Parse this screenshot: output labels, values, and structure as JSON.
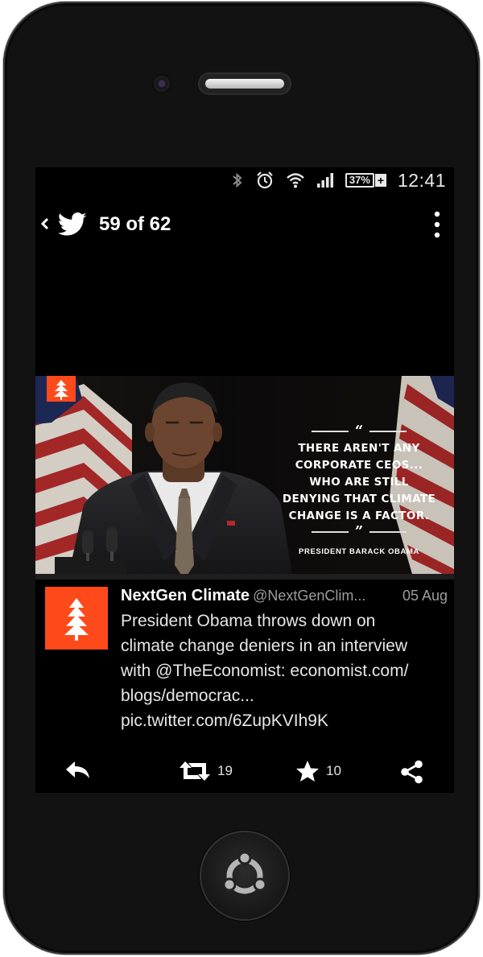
{
  "status_bar": {
    "battery_percent": "37%",
    "battery_plus": "+",
    "time": "12:41",
    "icons": [
      "bluetooth-icon",
      "alarm-icon",
      "wifi-icon",
      "signal-icon",
      "battery-icon"
    ]
  },
  "header": {
    "back_label": "‹",
    "counter": "59 of 62",
    "icons": [
      "back-icon",
      "twitter-bird-icon",
      "overflow-menu-icon"
    ]
  },
  "media": {
    "quote_open": "“",
    "quote_text": "There aren't any\ncorporate CEOs...\nwho are still\ndenying that climate\nchange is a factor.",
    "quote_close": "”",
    "attribution": "PRESIDENT BARACK OBAMA"
  },
  "tweet": {
    "author": "NextGen Climate",
    "handle": "@NextGenClim...",
    "date": "05 Aug",
    "text": "President Obama throws down on\nclimate change deniers in an interview\nwith @TheEconomist: economist.com/\nblogs/democrac...\npic.twitter.com/6ZupKVIh9K"
  },
  "actions": {
    "retweets": "19",
    "favorites": "10",
    "icons": [
      "reply-icon",
      "retweet-icon",
      "star-icon",
      "share-icon"
    ]
  },
  "colors": {
    "brand_orange": "#fe4a1b",
    "screen_bg": "#000000",
    "text_primary": "#e6e6e6",
    "text_secondary": "#9c9c9c"
  }
}
